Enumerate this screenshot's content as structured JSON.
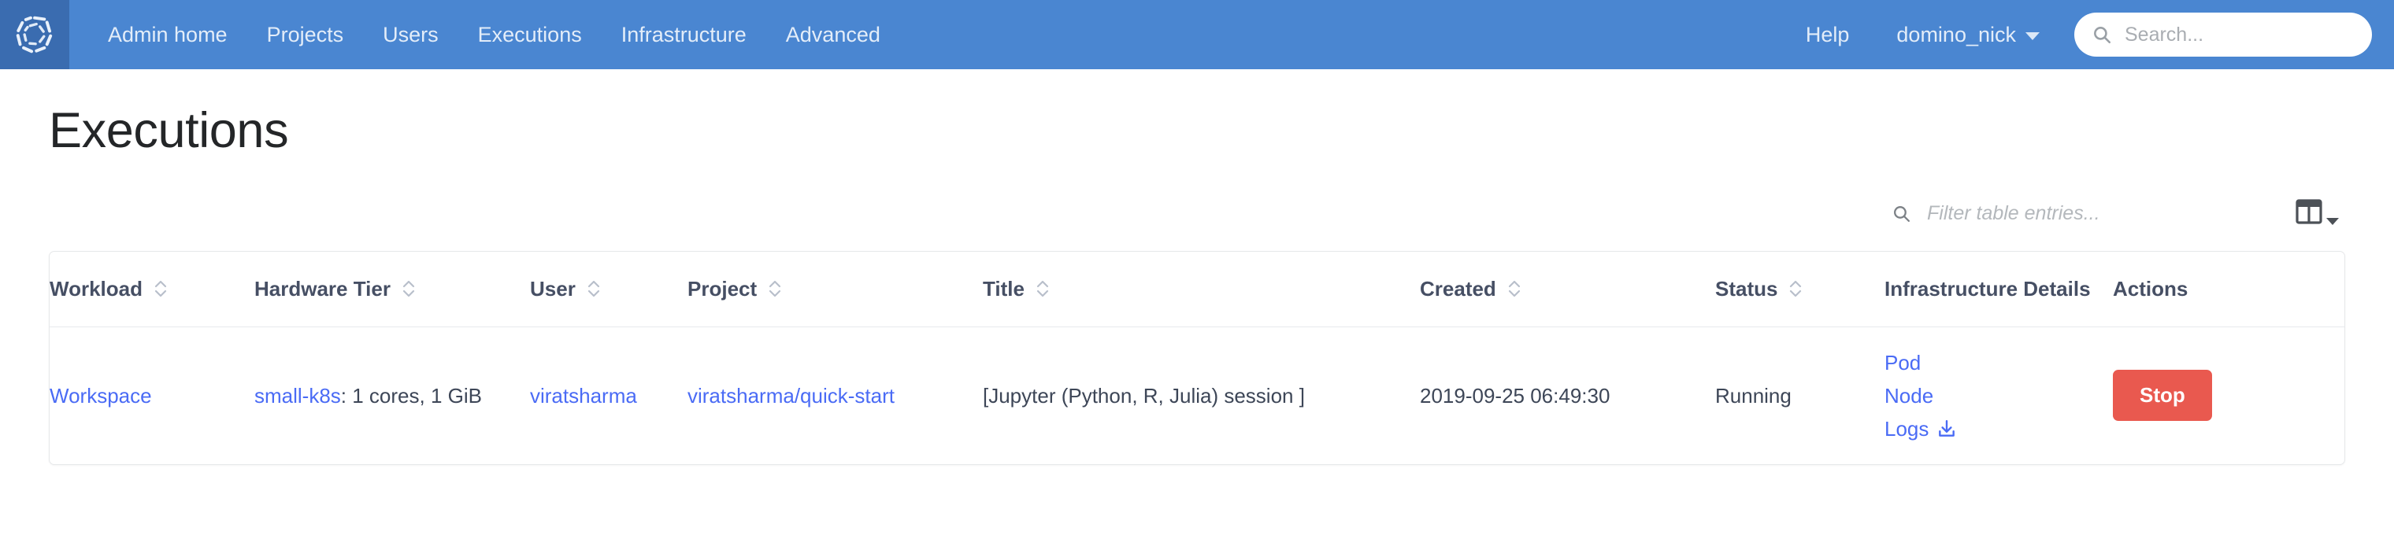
{
  "navbar": {
    "logo_name": "domino-logo",
    "links": [
      {
        "label": "Admin home",
        "name": "nav-admin-home"
      },
      {
        "label": "Projects",
        "name": "nav-projects"
      },
      {
        "label": "Users",
        "name": "nav-users"
      },
      {
        "label": "Executions",
        "name": "nav-executions"
      },
      {
        "label": "Infrastructure",
        "name": "nav-infrastructure"
      },
      {
        "label": "Advanced",
        "name": "nav-advanced"
      }
    ],
    "help_label": "Help",
    "user_label": "domino_nick",
    "search_placeholder": "Search...",
    "search_value": "",
    "bg_color": "#4a86d1",
    "logo_bg_color": "#3a6cb0"
  },
  "page": {
    "title": "Executions"
  },
  "toolbar": {
    "filter_placeholder": "Filter table entries...",
    "filter_value": "",
    "search_icon": "search-icon",
    "column_chooser_icon": "columns-icon"
  },
  "table": {
    "columns": [
      {
        "label": "Workload",
        "sortable": true
      },
      {
        "label": "Hardware Tier",
        "sortable": true
      },
      {
        "label": "User",
        "sortable": true
      },
      {
        "label": "Project",
        "sortable": true
      },
      {
        "label": "Title",
        "sortable": true
      },
      {
        "label": "Created",
        "sortable": true
      },
      {
        "label": "Status",
        "sortable": true
      },
      {
        "label": "Infrastructure Details",
        "sortable": false
      },
      {
        "label": "Actions",
        "sortable": false
      }
    ],
    "rows": [
      {
        "workload": "Workspace",
        "hardware_tier_link": "small-k8s",
        "hardware_tier_rest": ": 1 cores, 1 GiB",
        "user": "viratsharma",
        "project": "viratsharma/quick-start",
        "title": "[Jupyter (Python, R, Julia) session ]",
        "created": "2019-09-25 06:49:30",
        "status": "Running",
        "infrastructure": [
          {
            "label": "Pod",
            "icon": null
          },
          {
            "label": "Node",
            "icon": null
          },
          {
            "label": "Logs",
            "icon": "download-icon"
          }
        ],
        "action_label": "Stop"
      }
    ]
  },
  "colors": {
    "link": "#4a6bf5",
    "danger": "#e9594f",
    "header_text": "#464f64"
  }
}
